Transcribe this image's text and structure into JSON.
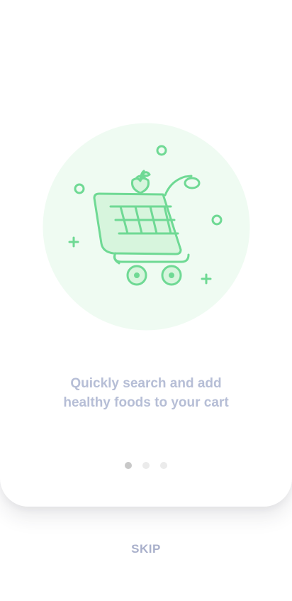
{
  "onboarding": {
    "caption_line1": "Quickly search and add",
    "caption_line2": "healthy foods to your cart",
    "skip_label": "SKIP",
    "illustration_icon": "shopping-cart-with-apple-icon",
    "page_count": 3,
    "active_page": 1
  },
  "colors": {
    "caption": "#b6bed6",
    "skip": "#a9b0cb",
    "dot_active": "#c8c8c8",
    "dot_inactive": "#ebebeb",
    "illustration_bg": "#effbf2",
    "illustration_stroke": "#6fd994",
    "illustration_fill": "#d7f5dd"
  }
}
